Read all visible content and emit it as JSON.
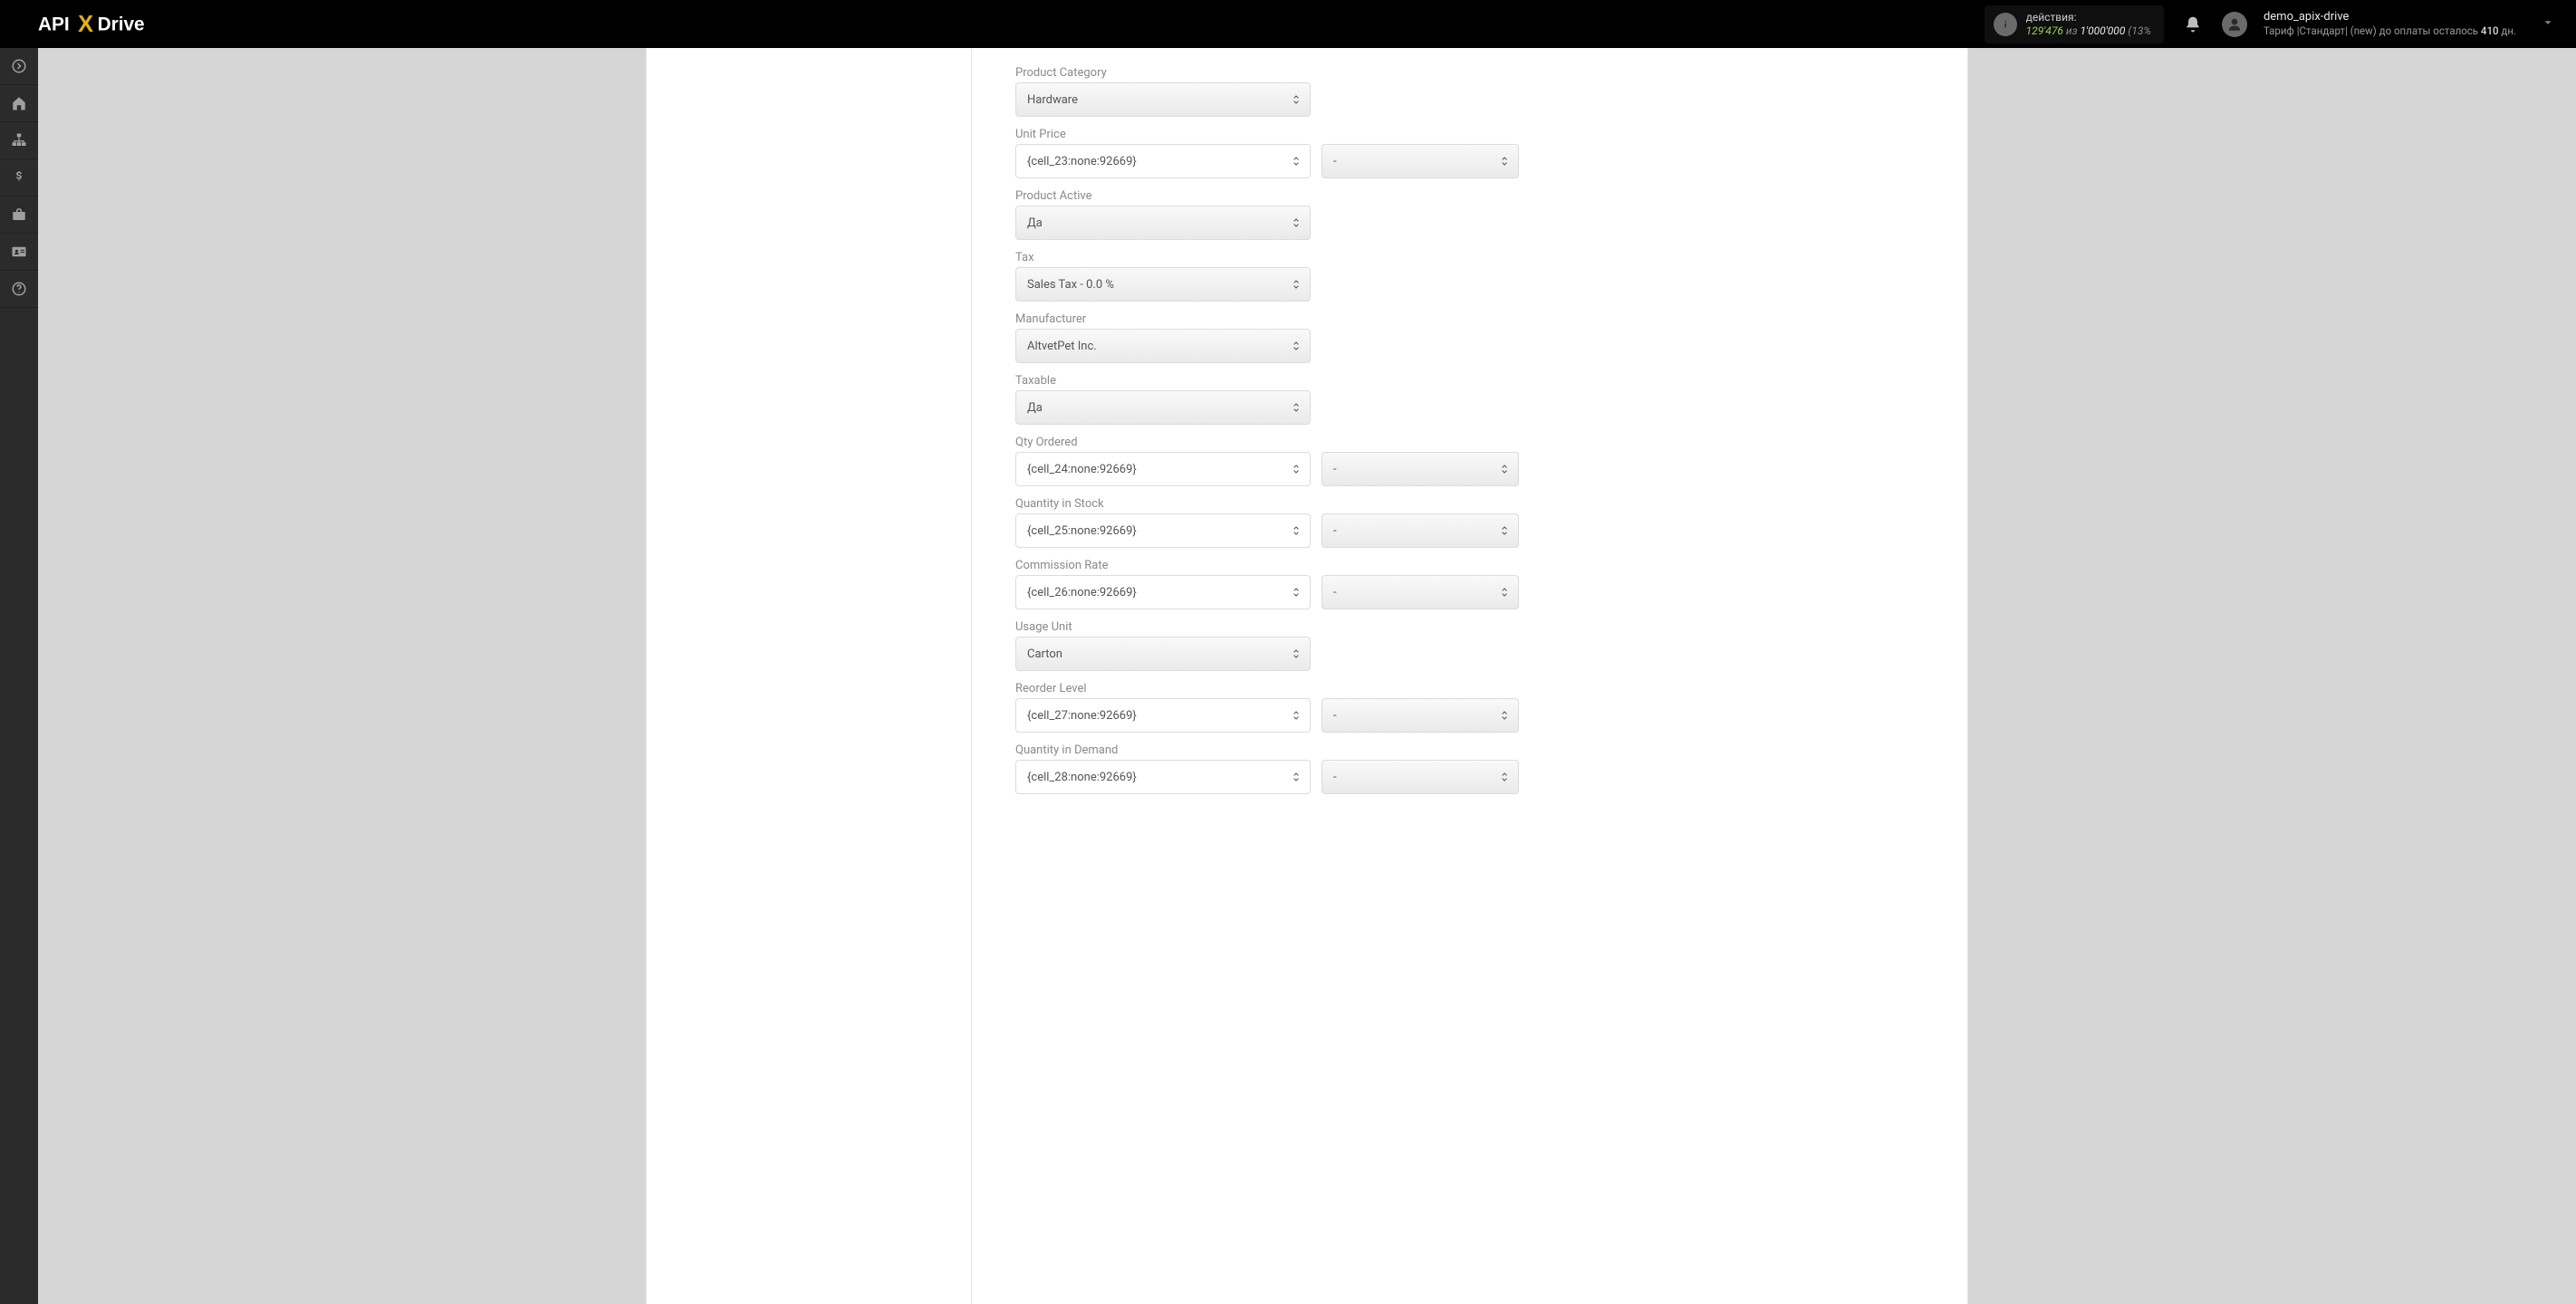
{
  "header": {
    "logo_text": "API X Drive",
    "info": {
      "title": "действия:",
      "used": "129'476",
      "sep": "из",
      "limit": "1'000'000",
      "pct": "(13%"
    },
    "user": {
      "name": "demo_apix-drive",
      "tariff_prefix": "Тариф |",
      "tariff_name": "Стандарт",
      "tariff_suffix": "| (new) до оплаты осталось",
      "tariff_days": "410",
      "tariff_days_suffix": "дн."
    }
  },
  "sidenav": {
    "items": [
      {
        "name": "arrow-right-icon"
      },
      {
        "name": "home-icon"
      },
      {
        "name": "sitemap-icon"
      },
      {
        "name": "dollar-icon"
      },
      {
        "name": "briefcase-icon"
      },
      {
        "name": "id-card-icon"
      },
      {
        "name": "question-icon"
      }
    ]
  },
  "form": {
    "fields": [
      {
        "label": "Product Category",
        "kind": "select",
        "value": "Hardware"
      },
      {
        "label": "Unit Price",
        "kind": "input",
        "value": "{cell_23:none:92669}",
        "secondary": "-"
      },
      {
        "label": "Product Active",
        "kind": "select",
        "value": "Да"
      },
      {
        "label": "Tax",
        "kind": "select",
        "value": "Sales Tax - 0.0 %"
      },
      {
        "label": "Manufacturer",
        "kind": "select",
        "value": "AltvetPet Inc."
      },
      {
        "label": "Taxable",
        "kind": "select",
        "value": "Да"
      },
      {
        "label": "Qty Ordered",
        "kind": "input",
        "value": "{cell_24:none:92669}",
        "secondary": "-"
      },
      {
        "label": "Quantity in Stock",
        "kind": "input",
        "value": "{cell_25:none:92669}",
        "secondary": "-"
      },
      {
        "label": "Commission Rate",
        "kind": "input",
        "value": "{cell_26:none:92669}",
        "secondary": "-"
      },
      {
        "label": "Usage Unit",
        "kind": "select",
        "value": "Carton"
      },
      {
        "label": "Reorder Level",
        "kind": "input",
        "value": "{cell_27:none:92669}",
        "secondary": "-"
      },
      {
        "label": "Quantity in Demand",
        "kind": "input",
        "value": "{cell_28:none:92669}",
        "secondary": "-"
      }
    ]
  }
}
